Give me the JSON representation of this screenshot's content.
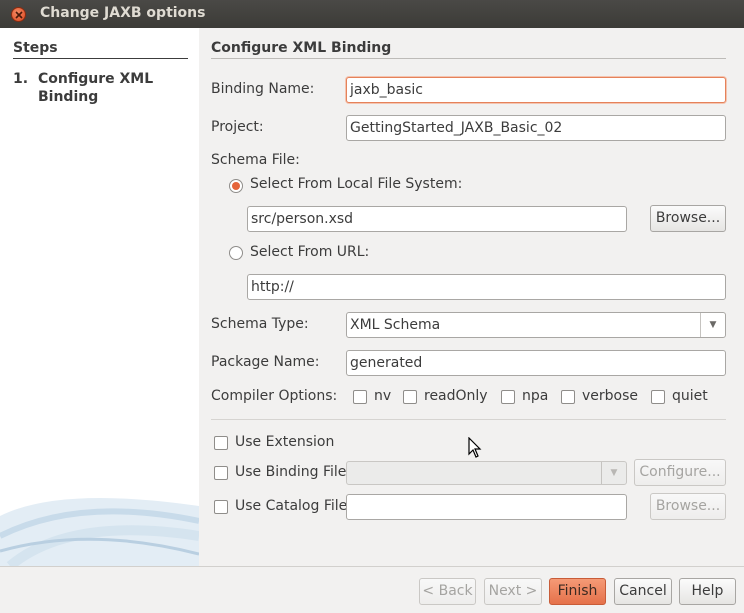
{
  "window": {
    "title": "Change JAXB options"
  },
  "steps": {
    "header": "Steps",
    "items": [
      {
        "number": "1.",
        "label": "Configure XML Binding"
      }
    ]
  },
  "main": {
    "section_title": "Configure XML Binding",
    "binding_name": {
      "label": "Binding Name:",
      "value": "jaxb_basic"
    },
    "project": {
      "label": "Project:",
      "value": "GettingStarted_JAXB_Basic_02"
    },
    "schema_file": {
      "label": "Schema File:",
      "local_option": "Select From Local File System:",
      "local_value": "src/person.xsd",
      "browse_label": "Browse...",
      "url_option": "Select From URL:",
      "url_value": "http://"
    },
    "schema_type": {
      "label": "Schema Type:",
      "value": "XML Schema"
    },
    "package_name": {
      "label": "Package Name:",
      "value": "generated"
    },
    "compiler_options": {
      "label": "Compiler Options:",
      "options": [
        "nv",
        "readOnly",
        "npa",
        "verbose",
        "quiet"
      ]
    },
    "use_extension": "Use Extension",
    "use_binding_file": {
      "label": "Use Binding File",
      "configure_label": "Configure..."
    },
    "use_catalog_file": {
      "label": "Use Catalog File",
      "browse_label": "Browse..."
    }
  },
  "footer": {
    "back": "< Back",
    "next": "Next >",
    "finish": "Finish",
    "cancel": "Cancel",
    "help": "Help"
  },
  "colors": {
    "accent": "#e5714a",
    "titlebar": "#3c3b37",
    "focus_border": "#e5825a"
  }
}
